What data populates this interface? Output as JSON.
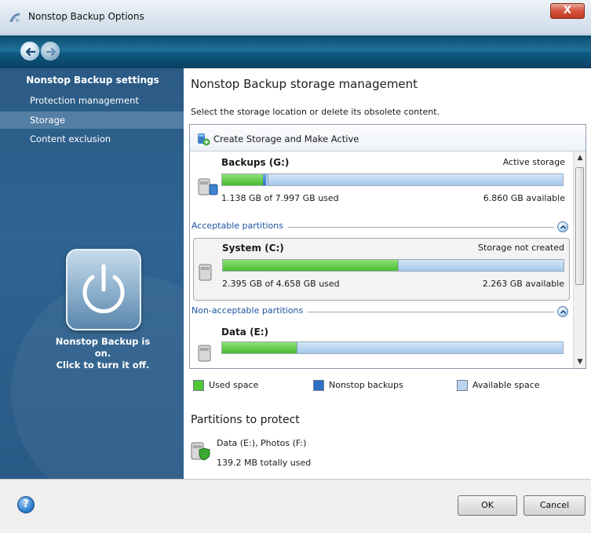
{
  "window": {
    "title": "Nonstop Backup Options",
    "close_label": "X"
  },
  "sidebar": {
    "heading": "Nonstop Backup settings",
    "items": [
      {
        "label": "Protection management",
        "active": false
      },
      {
        "label": "Storage",
        "active": true
      },
      {
        "label": "Content exclusion",
        "active": false
      }
    ],
    "status_line1": "Nonstop Backup is",
    "status_line2": "on.",
    "status_line3": "Click to turn it off."
  },
  "main": {
    "title": "Nonstop Backup storage management",
    "description": "Select the storage location or delete its obsolete content.",
    "toolbar": {
      "create_label": "Create Storage and Make Active"
    },
    "drives": [
      {
        "name": "Backups (G:)",
        "status": "Active storage",
        "used": "1.138 GB of 7.997 GB used",
        "available": "6.860 GB available",
        "used_fraction": 0.12,
        "backup_fraction": 0.005
      },
      {
        "name": "System (C:)",
        "status": "Storage not created",
        "used": "2.395 GB of 4.658 GB used",
        "available": "2.263 GB available",
        "used_fraction": 0.514,
        "backup_fraction": 0.0
      },
      {
        "name": "Data (E:)",
        "used_fraction": 0.22,
        "backup_fraction": 0.0
      }
    ],
    "sections": {
      "acceptable": "Acceptable partitions",
      "non_acceptable": "Non-acceptable partitions"
    },
    "legend": {
      "used": "Used space",
      "backups": "Nonstop backups",
      "available": "Available space"
    },
    "protect": {
      "title": "Partitions to protect",
      "partitions": "Data (E:), Photos (F:)",
      "size": "139.2 MB totally used"
    }
  },
  "footer": {
    "ok_label": "OK",
    "cancel_label": "Cancel",
    "help_label": "?"
  },
  "colors": {
    "used": "#47bd2e",
    "backups": "#2d6fc4",
    "available": "#b9d4ef",
    "sidebar": "#2f6391",
    "section_text": "#1c53a1"
  }
}
